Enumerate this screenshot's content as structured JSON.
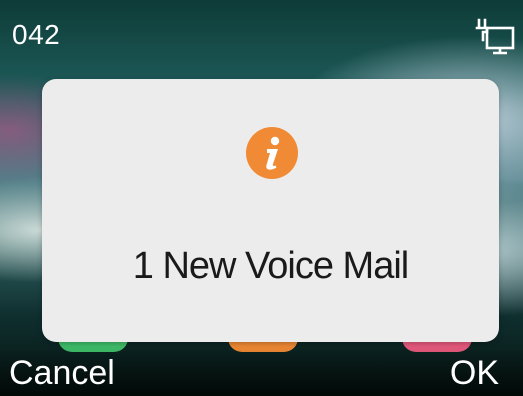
{
  "status_bar": {
    "label": "042",
    "network_icon": "network-computer-icon"
  },
  "dialog": {
    "icon": "info-icon",
    "icon_color": "#f08a34",
    "message": "1 New Voice Mail"
  },
  "softkeys": {
    "left_label": "Cancel",
    "right_label": "OK"
  },
  "colors": {
    "dialog_background": "#ececec",
    "accent_orange": "#f08a34",
    "key_green": "#3fbf6a",
    "key_pink": "#e85a7e"
  }
}
